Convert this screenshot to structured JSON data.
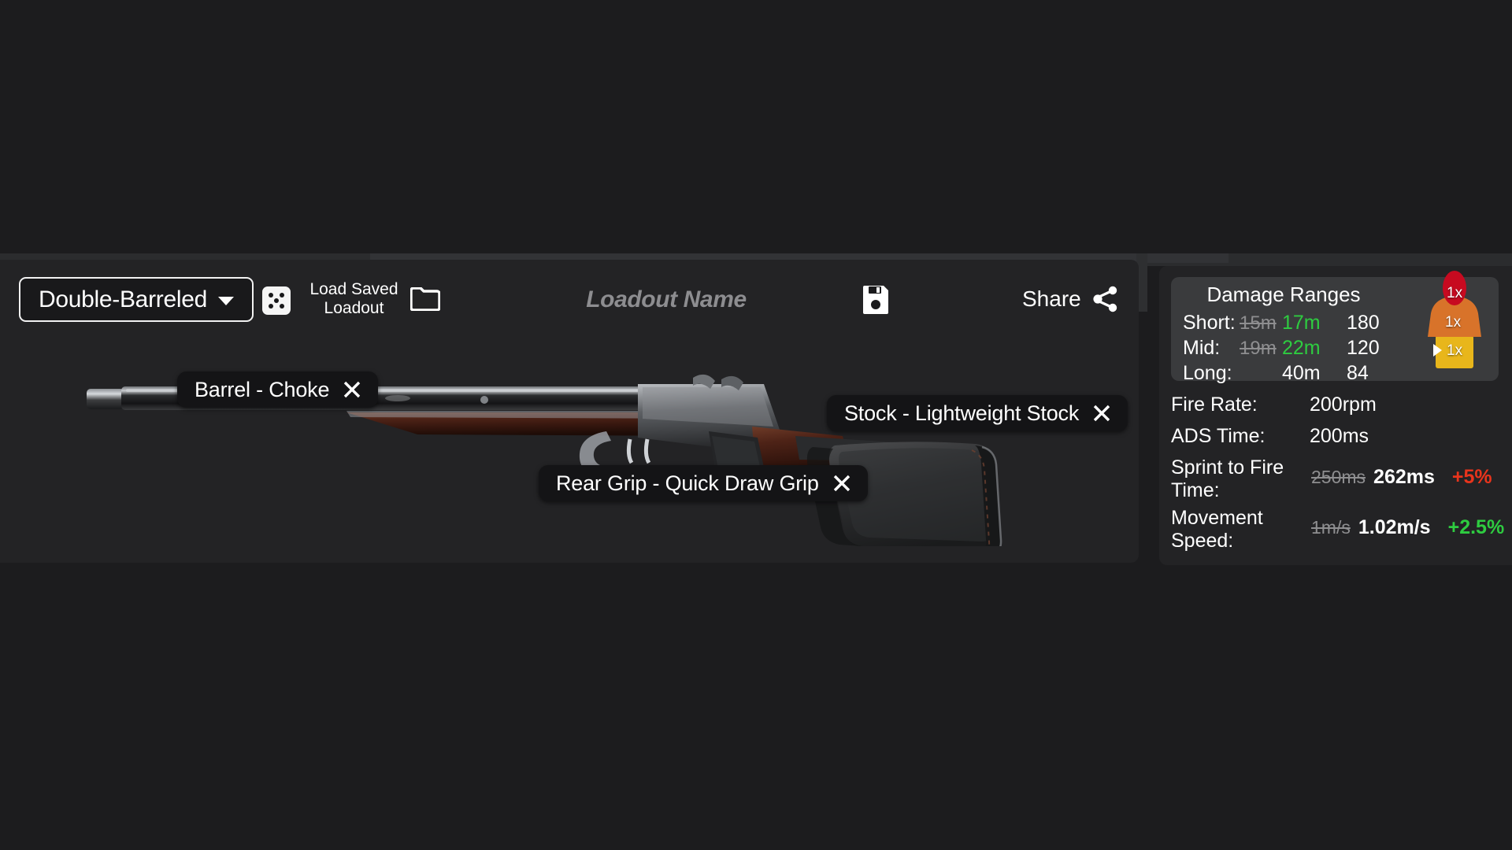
{
  "toolbar": {
    "weapon_selector": {
      "value": "Double-Barreled",
      "icon": "chevron-down-icon"
    },
    "randomize": {
      "icon": "dice-icon",
      "face": 5
    },
    "load_saved": {
      "label": "Load Saved Loadout",
      "icon": "folder-icon"
    },
    "loadout_name": {
      "value": "",
      "placeholder": "Loadout Name"
    },
    "save": {
      "icon": "floppy-disk-save-icon"
    },
    "share": {
      "label": "Share",
      "icon": "share-icon"
    }
  },
  "weapon": {
    "name": "Double-Barreled",
    "art": "double-barreled-shotgun"
  },
  "attachments": [
    {
      "slot": "Barrel",
      "name": "Choke",
      "label": "Barrel - Choke",
      "remove_icon": "close-x-icon"
    },
    {
      "slot": "Stock",
      "name": "Lightweight Stock",
      "label": "Stock - Lightweight Stock",
      "remove_icon": "close-x-icon"
    },
    {
      "slot": "Rear Grip",
      "name": "Quick Draw Grip",
      "label": "Rear Grip - Quick Draw Grip",
      "remove_icon": "close-x-icon"
    }
  ],
  "damage_ranges": {
    "title": "Damage Ranges",
    "rows": [
      {
        "label": "Short:",
        "old": "15m",
        "new": "17m",
        "changed": true,
        "damage": "180"
      },
      {
        "label": "Mid:",
        "old": "19m",
        "new": "22m",
        "changed": true,
        "damage": "120"
      },
      {
        "label": "Long:",
        "old": "",
        "new": "40m",
        "changed": false,
        "damage": "84"
      }
    ],
    "multipliers": {
      "head": "1x",
      "body": "1x",
      "legs": "1x"
    },
    "colors": {
      "head": "#c70a20",
      "body": "#d8732a",
      "legs": "#e8b61b",
      "improved": "#2ecc40",
      "worsened": "#e8341c",
      "struck": "#8e8e90"
    }
  },
  "stats": [
    {
      "label": "Fire Rate:",
      "inline": "200rpm",
      "old": "",
      "new": "",
      "delta": "",
      "delta_dir": ""
    },
    {
      "label": "ADS Time:",
      "inline": "200ms",
      "old": "",
      "new": "",
      "delta": "",
      "delta_dir": ""
    },
    {
      "label": "Sprint to Fire Time:",
      "inline": "",
      "old": "250ms",
      "new": "262ms",
      "delta": "+5%",
      "delta_dir": "down"
    },
    {
      "label": "Movement Speed:",
      "inline": "",
      "old": "1m/s",
      "new": "1.02m/s",
      "delta": "+2.5%",
      "delta_dir": "up"
    }
  ]
}
